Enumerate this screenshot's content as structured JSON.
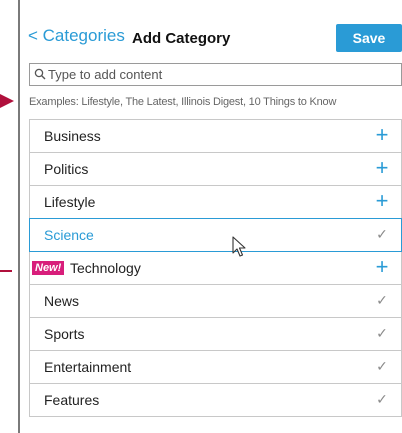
{
  "header": {
    "back_label": "< Categories",
    "title": "Add Category",
    "save_label": "Save"
  },
  "search": {
    "placeholder": "Type to add content"
  },
  "examples_text": "Examples: Lifestyle, The Latest, Illinois Digest, 10 Things to Know",
  "categories": [
    {
      "label": "Business",
      "state": "add",
      "icon": "plus-icon"
    },
    {
      "label": "Politics",
      "state": "add",
      "icon": "plus-icon"
    },
    {
      "label": "Lifestyle",
      "state": "add",
      "icon": "plus-icon"
    },
    {
      "label": "Science",
      "state": "added",
      "selected": true,
      "icon": "check-icon"
    },
    {
      "label": "Technology",
      "state": "add",
      "badge": "New!",
      "icon": "plus-icon"
    },
    {
      "label": "News",
      "state": "added",
      "icon": "check-icon"
    },
    {
      "label": "Sports",
      "state": "added",
      "icon": "check-icon"
    },
    {
      "label": "Entertainment",
      "state": "added",
      "icon": "check-icon"
    },
    {
      "label": "Features",
      "state": "added",
      "icon": "check-icon"
    }
  ],
  "colors": {
    "accent": "#2a9bd6",
    "badge": "#d81e7b",
    "callout": "#b0103c"
  }
}
